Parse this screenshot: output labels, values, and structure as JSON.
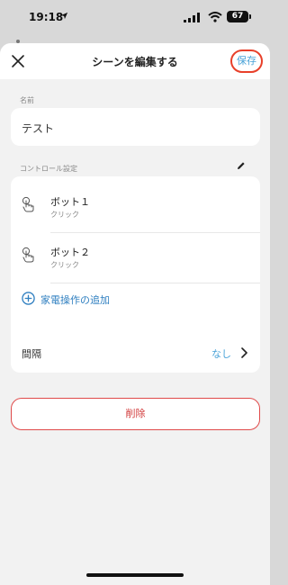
{
  "status_bar": {
    "time": "19:18",
    "battery": "67"
  },
  "nav": {
    "title": "シーンを編集する",
    "save_label": "保存"
  },
  "name_section": {
    "label": "名前",
    "value": "テスト"
  },
  "control_section": {
    "label": "コントロール設定",
    "items": [
      {
        "name": "ボット１",
        "action": "クリック"
      },
      {
        "name": "ボット２",
        "action": "クリック"
      }
    ],
    "add_label": "家電操作の追加"
  },
  "interval": {
    "label": "間隔",
    "value": "なし"
  },
  "delete_label": "削除",
  "colors": {
    "accent_blue": "#4aa3d8",
    "link_blue": "#2f7fc0",
    "delete_red": "#d13a3a",
    "highlight_red": "#e8402a"
  }
}
